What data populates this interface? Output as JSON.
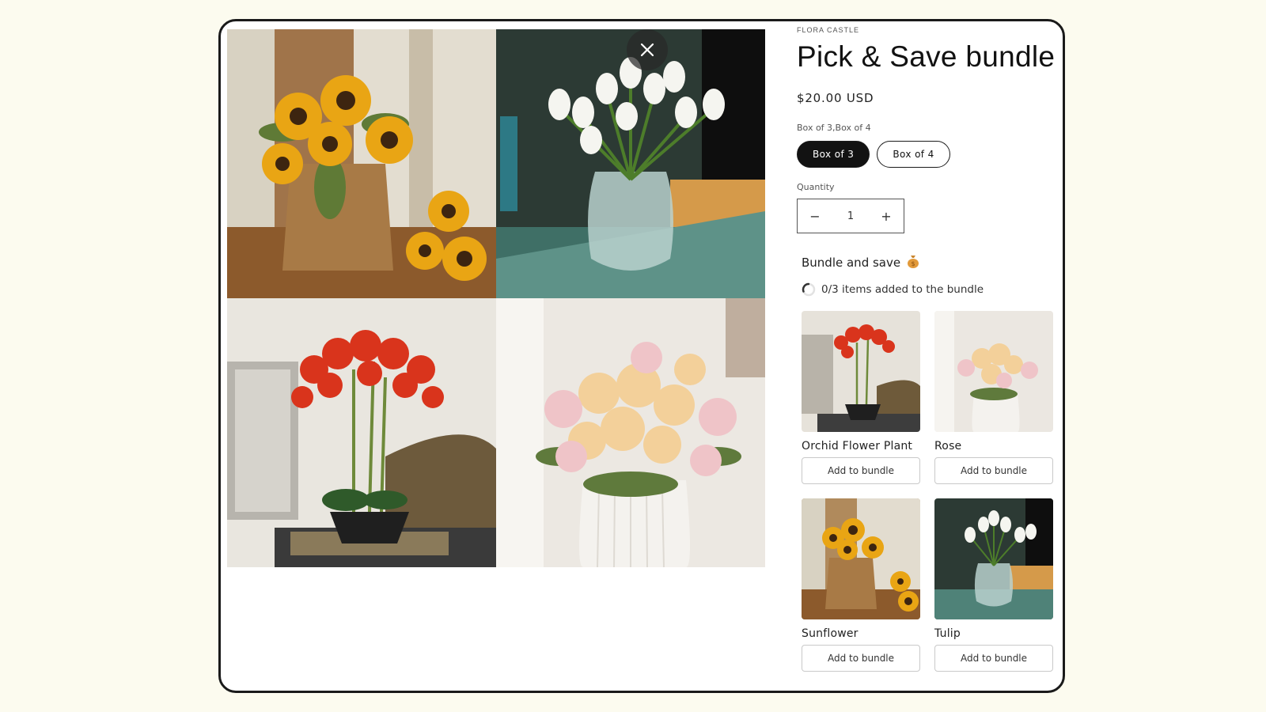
{
  "close_icon": "close-icon",
  "gallery": {
    "images": [
      {
        "name": "sunflower-image"
      },
      {
        "name": "tulip-image"
      },
      {
        "name": "orchid-image"
      },
      {
        "name": "rose-image"
      }
    ]
  },
  "product": {
    "vendor": "FLORA CASTLE",
    "title": "Pick & Save bundle",
    "price": "$20.00 USD",
    "variant_label": "Box of 3,Box of 4",
    "variants": [
      {
        "label": "Box of 3",
        "selected": true
      },
      {
        "label": "Box of 4",
        "selected": false
      }
    ],
    "quantity_label": "Quantity",
    "quantity": "1",
    "decrease_symbol": "−",
    "increase_symbol": "+"
  },
  "bundle": {
    "title": "Bundle and save",
    "title_icon": "money-bag-icon",
    "progress_text": "0/3 items added to the bundle",
    "progress_icon": "spinner-icon",
    "items": [
      {
        "name": "Orchid Flower Plant",
        "button": "Add to bundle",
        "image": "orchid"
      },
      {
        "name": "Rose",
        "button": "Add to bundle",
        "image": "rose"
      },
      {
        "name": "Sunflower",
        "button": "Add to bundle",
        "image": "sunflower"
      },
      {
        "name": "Tulip",
        "button": "Add to bundle",
        "image": "tulip"
      }
    ]
  },
  "colors": {
    "page_background": "#fcfbef",
    "button_dark": "#121212",
    "sunflower_yellow": "#e9a514",
    "orchid_red": "#d9341c",
    "rose_peach": "#f3d09a"
  }
}
